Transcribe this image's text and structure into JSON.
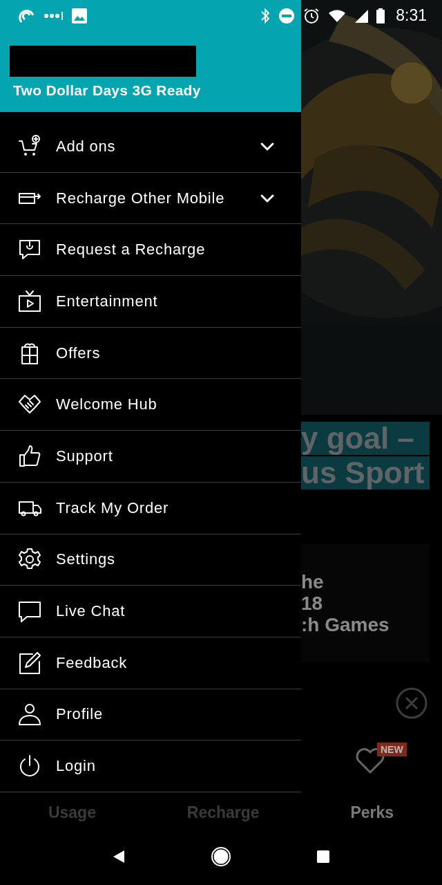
{
  "status_bar": {
    "time": "8:31"
  },
  "drawer": {
    "plan": "Two Dollar Days 3G Ready",
    "menu": [
      {
        "label": "Add ons",
        "kind": "group",
        "expanded": false
      },
      {
        "label": "Recharge Other Mobile",
        "kind": "group",
        "expanded": false
      },
      {
        "label": "Request a Recharge",
        "kind": "link"
      },
      {
        "label": "Entertainment",
        "kind": "link"
      },
      {
        "label": "Offers",
        "kind": "link"
      },
      {
        "label": "Welcome Hub",
        "kind": "link"
      },
      {
        "label": "Support",
        "kind": "link"
      },
      {
        "label": "Track My Order",
        "kind": "link"
      },
      {
        "label": "Settings",
        "kind": "link"
      },
      {
        "label": "Live Chat",
        "kind": "link"
      },
      {
        "label": "Feedback",
        "kind": "link"
      },
      {
        "label": "Profile",
        "kind": "link"
      },
      {
        "label": "Login",
        "kind": "link"
      }
    ]
  },
  "background": {
    "headline": [
      "y goal –",
      "us Sport"
    ],
    "card_lines": [
      "he",
      "18",
      ":h Games"
    ]
  },
  "bottom_nav": [
    {
      "label": "Usage",
      "selected": false
    },
    {
      "label": "Recharge",
      "selected": false
    },
    {
      "label": "Perks",
      "selected": true,
      "badge": "NEW"
    }
  ]
}
